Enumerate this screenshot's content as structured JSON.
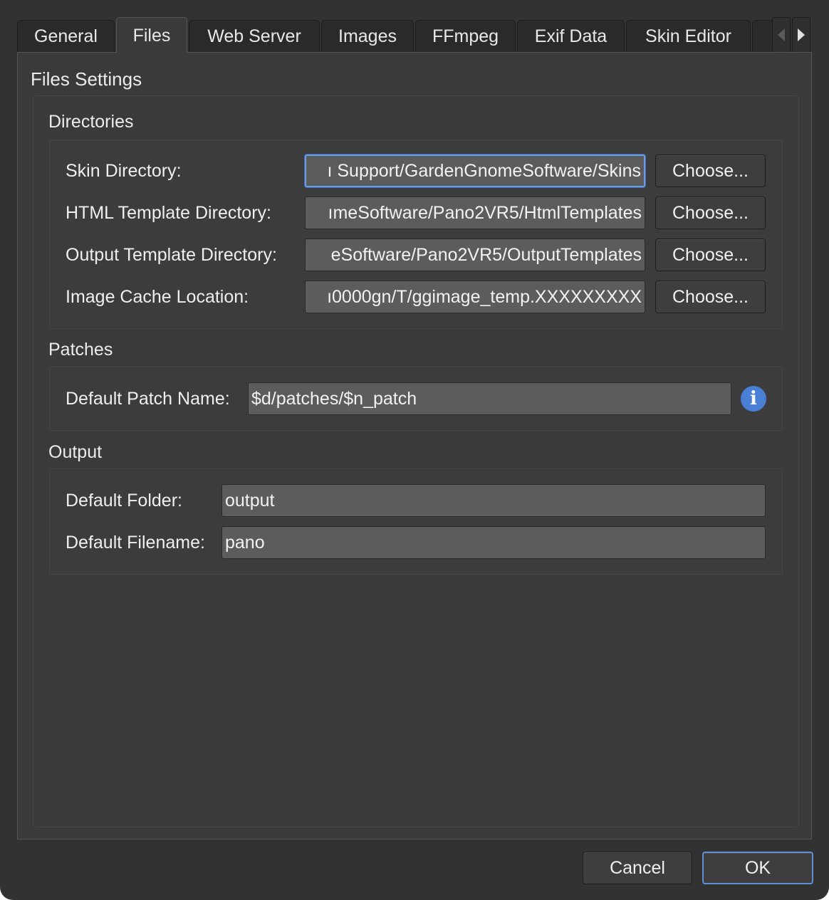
{
  "tabs": [
    {
      "label": "General"
    },
    {
      "label": "Files"
    },
    {
      "label": "Web Server"
    },
    {
      "label": "Images"
    },
    {
      "label": "FFmpeg"
    },
    {
      "label": "Exif Data"
    },
    {
      "label": "Skin Editor"
    }
  ],
  "active_tab": "Files",
  "page_title": "Files Settings",
  "directories": {
    "title": "Directories",
    "rows": [
      {
        "label": "Skin Directory:",
        "value": "ı Support/GardenGnomeSoftware/Skins",
        "button": "Choose..."
      },
      {
        "label": "HTML Template Directory:",
        "value": "ımeSoftware/Pano2VR5/HtmlTemplates",
        "button": "Choose..."
      },
      {
        "label": "Output Template Directory:",
        "value": "eSoftware/Pano2VR5/OutputTemplates",
        "button": "Choose..."
      },
      {
        "label": "Image Cache Location:",
        "value": "ı0000gn/T/ggimage_temp.XXXXXXXXX",
        "button": "Choose..."
      }
    ]
  },
  "patches": {
    "title": "Patches",
    "label": "Default Patch Name:",
    "value": "$d/patches/$n_patch",
    "icon": "info-icon",
    "icon_glyph": "i"
  },
  "output": {
    "title": "Output",
    "folder_label": "Default Folder:",
    "folder_value": "output",
    "filename_label": "Default Filename:",
    "filename_value": "pano"
  },
  "footer": {
    "cancel_label": "Cancel",
    "ok_label": "OK"
  },
  "colors": {
    "background": "#323232",
    "panel": "#3a3a3a",
    "field": "#5c5c5c",
    "accent": "#4a7fd6"
  }
}
